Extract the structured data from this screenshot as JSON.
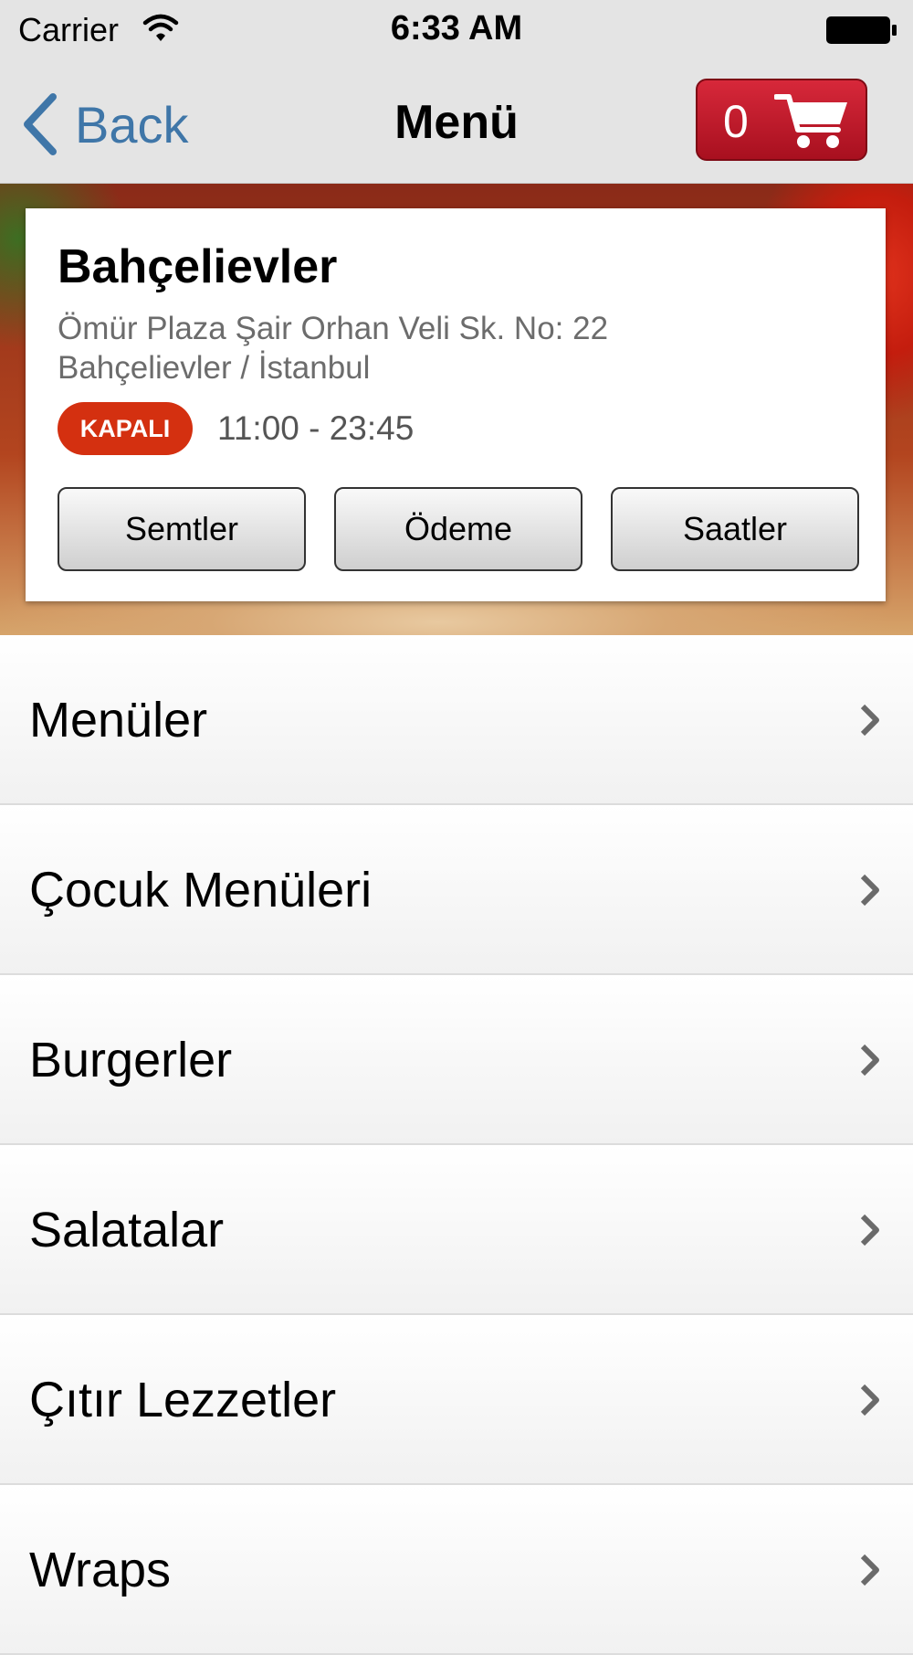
{
  "status_bar": {
    "carrier": "Carrier",
    "time": "6:33 AM"
  },
  "nav": {
    "back_label": "Back",
    "title": "Menü",
    "cart_count": "0"
  },
  "branch": {
    "name": "Bahçelievler",
    "address_line1": "Ömür Plaza Şair Orhan Veli Sk. No: 22",
    "address_line2": "Bahçelievler / İstanbul",
    "status": "KAPALI",
    "hours": "11:00 - 23:45",
    "buttons": [
      "Semtler",
      "Ödeme",
      "Saatler"
    ]
  },
  "categories": [
    {
      "label": "Menüler"
    },
    {
      "label": "Çocuk Menüleri"
    },
    {
      "label": "Burgerler"
    },
    {
      "label": "Salatalar"
    },
    {
      "label": "Çıtır Lezzetler"
    },
    {
      "label": "Wraps"
    }
  ],
  "colors": {
    "accent_blue": "#3f76a8",
    "cart_red": "#c41a2b",
    "status_red": "#d43010"
  }
}
